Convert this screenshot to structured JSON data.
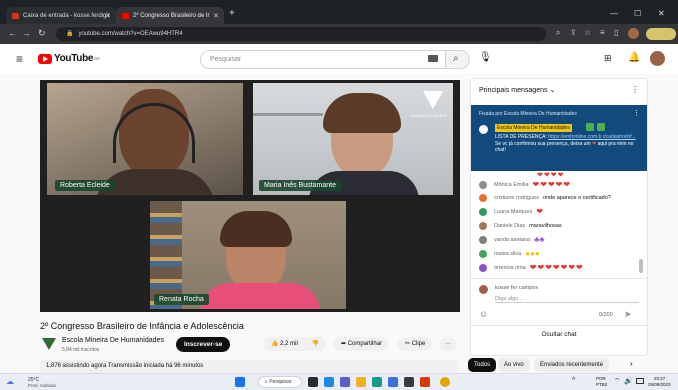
{
  "browser": {
    "tabs": [
      {
        "label": "Caixa de entrada - kosse.ferdigir",
        "favicon_color": "#d93025"
      },
      {
        "label": "2º Congresso Brasileiro de Ir",
        "favicon_color": "#ff0000"
      }
    ],
    "new_tab": "+",
    "url": "youtube.com/watch?v=OEAwu94HTR4"
  },
  "youtube": {
    "logo": "YouTube",
    "logo_sup": "BR",
    "search_placeholder": "Pesquisar"
  },
  "video": {
    "participants": [
      {
        "name": "Roberta Ecleide"
      },
      {
        "name": "Maria Inês Bustamante"
      },
      {
        "name": "Renata Rocha"
      }
    ],
    "watermark": "HUMANIDADES"
  },
  "meta": {
    "title": "2º Congresso Brasileiro de Infância e Adolescência",
    "channel": "Escola Mineira De Humanidades",
    "subscribers": "5,84 mil inscritos",
    "subscribe": "Inscrever-se",
    "likes": "2,2 mil",
    "share": "Compartilhar",
    "clip": "Clipe",
    "more": "···",
    "views": "1.876 assistindo agora  Transmissão iniciada há 96 minutos"
  },
  "chat": {
    "header": "Principais mensagens",
    "pinned_by": "Fixada por Escola Mineira De Humanidades",
    "pinned_author": "Escola Mineira De Humanidades",
    "pinned_line1": "LISTA DE PRESENÇA:",
    "pinned_link": "https://emhonline.com.b r/cadastro/inf...",
    "pinned_line2": "Se vc já confirmou sua presença, deixa um",
    "pinned_line3": "aqui pra mim no chat!",
    "messages": [
      {
        "author": "Mônica Emília",
        "text": "",
        "emoji": "hearts5",
        "color": "#8e8e8e"
      },
      {
        "author": "cristiane rodrigues",
        "text": "onde aparece o certificado?",
        "emoji": "",
        "color": "#e8712a"
      },
      {
        "author": "Luana Marques",
        "text": "",
        "emoji": "heart1",
        "color": "#2e9e60"
      },
      {
        "author": "Daniele Dias",
        "text": "maravilhosas",
        "emoji": "",
        "color": "#a0785a"
      },
      {
        "author": "vanda santana",
        "text": "",
        "emoji": "purple",
        "color": "#7e7e7e"
      },
      {
        "author": "maisa silva",
        "text": "",
        "emoji": "yellow",
        "color": "#3ea55b"
      },
      {
        "author": "ortencia rima",
        "text": "",
        "emoji": "hearts7",
        "color": "#8a55c8"
      }
    ],
    "user_name": "kosse fer campos",
    "input_placeholder": "Diga algo...",
    "counter": "0/200",
    "hide_chat": "Ocultar chat"
  },
  "chips": [
    "Todos",
    "Ao vivo",
    "Enviados recentemente"
  ],
  "taskbar": {
    "weather_temp": "25°C",
    "weather_text": "Pred. nublado",
    "search": "Pesquisar",
    "lang": "POR",
    "lang2": "PTB2",
    "time": "20:27",
    "date": "25/09/2023"
  }
}
